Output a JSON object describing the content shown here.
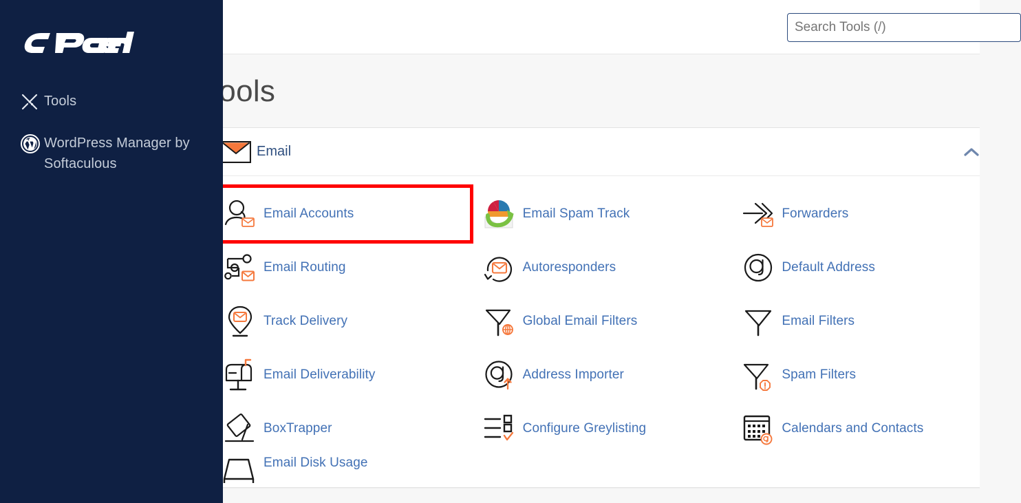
{
  "sidebar": {
    "logo_text": "cPanel",
    "items": [
      {
        "label": "Tools",
        "icon": "tools-icon"
      },
      {
        "label": "WordPress Manager by Softaculous",
        "icon": "wordpress-icon"
      }
    ]
  },
  "topbar": {
    "search": {
      "placeholder": "Search Tools (/)",
      "value": ""
    }
  },
  "main": {
    "page_title": "Tools"
  },
  "panel": {
    "title": "Email",
    "icon": "envelope-icon",
    "collapse_icon": "chevron-up-icon",
    "expanded": true,
    "tools": [
      {
        "label": "Email Accounts",
        "icon": "user-envelope-icon",
        "highlighted": true
      },
      {
        "label": "Email Spam Track",
        "icon": "piechart-envelope-icon",
        "highlighted": false
      },
      {
        "label": "Forwarders",
        "icon": "arrows-envelope-icon",
        "highlighted": false
      },
      {
        "label": "Email Routing",
        "icon": "routing-envelope-icon",
        "highlighted": false
      },
      {
        "label": "Autoresponders",
        "icon": "circular-arrow-envelope-icon",
        "highlighted": false
      },
      {
        "label": "Default Address",
        "icon": "at-circle-icon",
        "highlighted": false
      },
      {
        "label": "Track Delivery",
        "icon": "map-pin-envelope-icon",
        "highlighted": false
      },
      {
        "label": "Global Email Filters",
        "icon": "funnel-globe-icon",
        "highlighted": false
      },
      {
        "label": "Email Filters",
        "icon": "funnel-icon",
        "highlighted": false
      },
      {
        "label": "Email Deliverability",
        "icon": "mailbox-icon",
        "highlighted": false
      },
      {
        "label": "Address Importer",
        "icon": "at-circle-arrow-icon",
        "highlighted": false
      },
      {
        "label": "Spam Filters",
        "icon": "funnel-alert-icon",
        "highlighted": false
      },
      {
        "label": "BoxTrapper",
        "icon": "box-trap-icon",
        "highlighted": false
      },
      {
        "label": "Configure Greylisting",
        "icon": "checklist-icon",
        "highlighted": false
      },
      {
        "label": "Calendars and Contacts",
        "icon": "calendar-at-icon",
        "highlighted": false
      },
      {
        "label": "Email Disk Usage",
        "icon": "disk-usage-icon",
        "highlighted": false
      }
    ]
  },
  "colors": {
    "sidebar_bg": "#0f2043",
    "accent_orange": "#f5783c",
    "link_blue": "#4271b5",
    "highlight_red": "#ff0000",
    "page_bg": "#f7f7f7"
  }
}
